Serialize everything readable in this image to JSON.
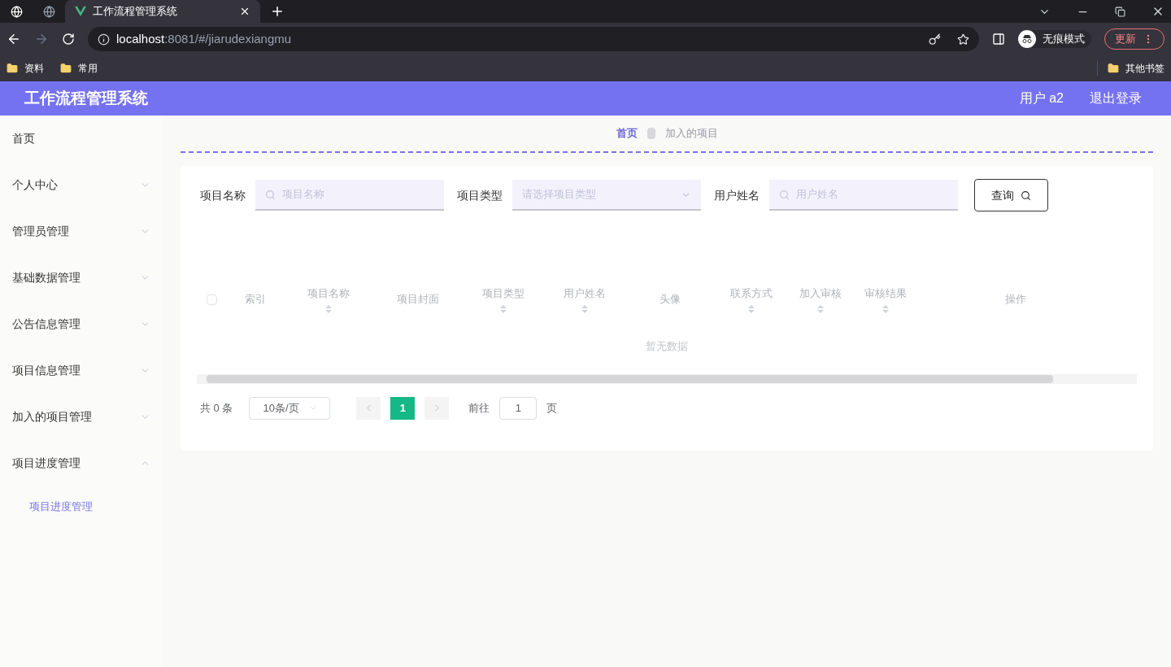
{
  "browser": {
    "tabs": [
      {
        "kind": "icon",
        "selected": false
      },
      {
        "kind": "icon",
        "selected": false
      },
      {
        "kind": "page",
        "title": "工作流程管理系统",
        "selected": true
      }
    ],
    "url_host": "localhost",
    "url_rest": ":8081/#/jiarudexiangmu",
    "incognito": "无痕模式",
    "update": "更新",
    "bookmarks": [
      "资料",
      "常用"
    ],
    "other_bookmarks": "其他书签"
  },
  "header": {
    "title": "工作流程管理系统",
    "user": "用户 a2",
    "logout": "退出登录"
  },
  "sidebar": {
    "items": [
      {
        "label": "首页",
        "expandable": false
      },
      {
        "label": "个人中心",
        "expandable": true
      },
      {
        "label": "管理员管理",
        "expandable": true
      },
      {
        "label": "基础数据管理",
        "expandable": true
      },
      {
        "label": "公告信息管理",
        "expandable": true
      },
      {
        "label": "项目信息管理",
        "expandable": true
      },
      {
        "label": "加入的项目管理",
        "expandable": true
      },
      {
        "label": "项目进度管理",
        "expandable": true,
        "children": [
          {
            "label": "项目进度管理"
          }
        ]
      }
    ]
  },
  "breadcrumb": [
    "首页",
    "加入的项目"
  ],
  "search": {
    "fields": [
      {
        "kind": "input",
        "label": "项目名称",
        "placeholder": "项目名称"
      },
      {
        "kind": "select",
        "label": "项目类型",
        "placeholder": "请选择项目类型"
      },
      {
        "kind": "input",
        "label": "用户姓名",
        "placeholder": "用户姓名"
      }
    ],
    "button": "查询"
  },
  "table": {
    "select_all_checked": false,
    "columns": [
      {
        "label": "索引",
        "sortable": false
      },
      {
        "label": "项目名称",
        "sortable": true
      },
      {
        "label": "项目封面",
        "sortable": false
      },
      {
        "label": "项目类型",
        "sortable": true
      },
      {
        "label": "用户姓名",
        "sortable": true
      },
      {
        "label": "头像",
        "sortable": false
      },
      {
        "label": "联系方式",
        "sortable": true
      },
      {
        "label": "加入审核",
        "sortable": true
      },
      {
        "label": "审核结果",
        "sortable": true
      },
      {
        "label": "操作",
        "sortable": false
      }
    ],
    "empty": "暂无数据"
  },
  "pagination": {
    "total": "共 0 条",
    "page_size": "10条/页",
    "pages": [
      {
        "label": "1",
        "selected": true
      }
    ],
    "goto": "前往",
    "goto_value": "1",
    "page_unit": "页"
  }
}
